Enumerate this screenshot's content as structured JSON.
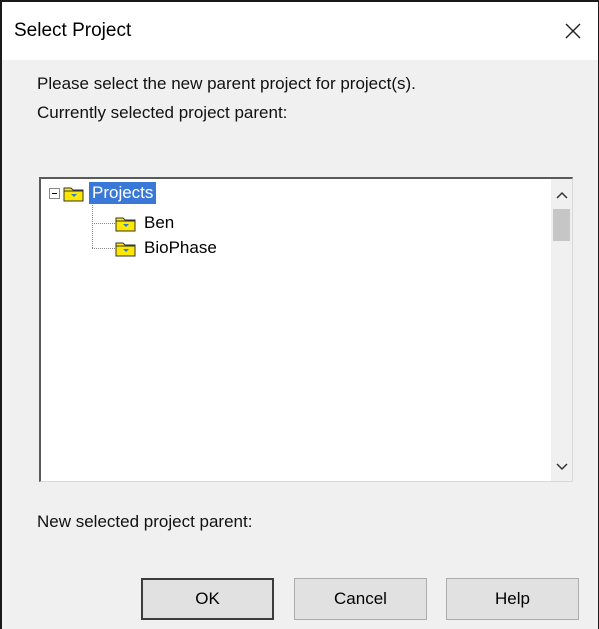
{
  "window": {
    "title": "Select Project",
    "close_glyph": "✕"
  },
  "messages": {
    "prompt": "Please select the new parent project for project(s).",
    "current_parent_label": "Currently selected project parent:",
    "new_parent_label": "New selected project parent:"
  },
  "tree": {
    "root": {
      "label": "Projects",
      "selected": true,
      "expanded": true
    },
    "children": [
      {
        "label": "Ben"
      },
      {
        "label": "BioPhase"
      }
    ]
  },
  "buttons": {
    "ok": "OK",
    "cancel": "Cancel",
    "help": "Help"
  },
  "icons": {
    "folder": "folder-icon",
    "close": "close-icon",
    "expand": "minus-box-icon"
  },
  "colors": {
    "selection": "#3a78d8",
    "folder_yellow": "#ffee00"
  }
}
